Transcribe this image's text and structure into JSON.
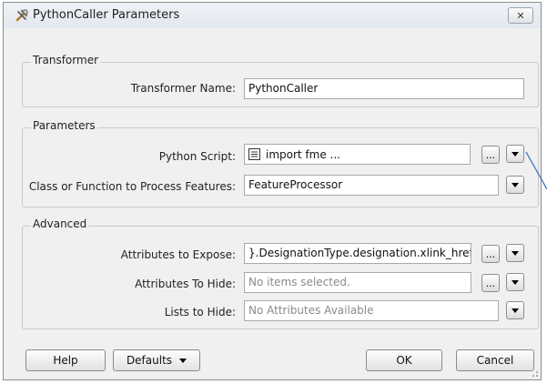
{
  "window": {
    "title": "PythonCaller Parameters",
    "close_icon": "close-icon"
  },
  "transformer": {
    "group_label": "Transformer",
    "name_label": "Transformer Name:",
    "name_value": "PythonCaller"
  },
  "parameters": {
    "group_label": "Parameters",
    "script_label": "Python Script:",
    "script_value": "import fme ...",
    "class_label": "Class or Function to Process Features:",
    "class_value": "FeatureProcessor"
  },
  "advanced": {
    "group_label": "Advanced",
    "expose_label": "Attributes to Expose:",
    "expose_value": "}.DesignationType.designation.xlink_href",
    "hide_label": "Attributes To Hide:",
    "hide_value": "No items selected.",
    "lists_label": "Lists to Hide:",
    "lists_value": "No Attributes Available"
  },
  "buttons": {
    "help": "Help",
    "defaults": "Defaults",
    "ok": "OK",
    "cancel": "Cancel",
    "ellipsis": "..."
  },
  "colors": {
    "accent_line": "#2f6db5"
  }
}
